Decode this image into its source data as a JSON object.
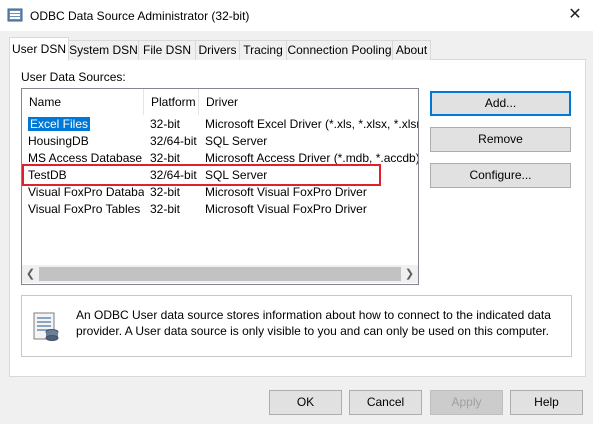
{
  "window": {
    "title": "ODBC Data Source Administrator (32-bit)",
    "close_glyph": "✕"
  },
  "tabs": [
    {
      "label": "User DSN",
      "active": true
    },
    {
      "label": "System DSN"
    },
    {
      "label": "File DSN"
    },
    {
      "label": "Drivers"
    },
    {
      "label": "Tracing"
    },
    {
      "label": "Connection Pooling"
    },
    {
      "label": "About"
    }
  ],
  "user_dsn": {
    "section_label": "User Data Sources:",
    "columns": [
      "Name",
      "Platform",
      "Driver"
    ],
    "rows": [
      {
        "name": "Excel Files",
        "platform": "32-bit",
        "driver": "Microsoft Excel Driver (*.xls, *.xlsx, *.xlsm, *.xlsb)",
        "selected": true
      },
      {
        "name": "HousingDB",
        "platform": "32/64-bit",
        "driver": "SQL Server"
      },
      {
        "name": "MS Access Database",
        "platform": "32-bit",
        "driver": "Microsoft Access Driver (*.mdb, *.accdb)"
      },
      {
        "name": "TestDB",
        "platform": "32/64-bit",
        "driver": "SQL Server",
        "highlighted": true
      },
      {
        "name": "Visual FoxPro Database",
        "platform": "32-bit",
        "driver": "Microsoft Visual FoxPro Driver"
      },
      {
        "name": "Visual FoxPro Tables",
        "platform": "32-bit",
        "driver": "Microsoft Visual FoxPro Driver"
      }
    ],
    "buttons": {
      "add": "Add...",
      "remove": "Remove",
      "configure": "Configure..."
    },
    "info": "An ODBC User data source stores information about how to connect to the indicated data provider.   A User data source is only visible to you and can only be used on this computer."
  },
  "footer": {
    "ok": "OK",
    "cancel": "Cancel",
    "apply": "Apply",
    "help": "Help"
  },
  "colors": {
    "selection": "#0078d7",
    "highlight_box": "#e0212b",
    "default_button_border": "#0078d7"
  },
  "icons": {
    "app": "odbc-admin-icon",
    "info": "database-document-icon",
    "left": "scroll-left-icon",
    "right": "scroll-right-icon"
  }
}
